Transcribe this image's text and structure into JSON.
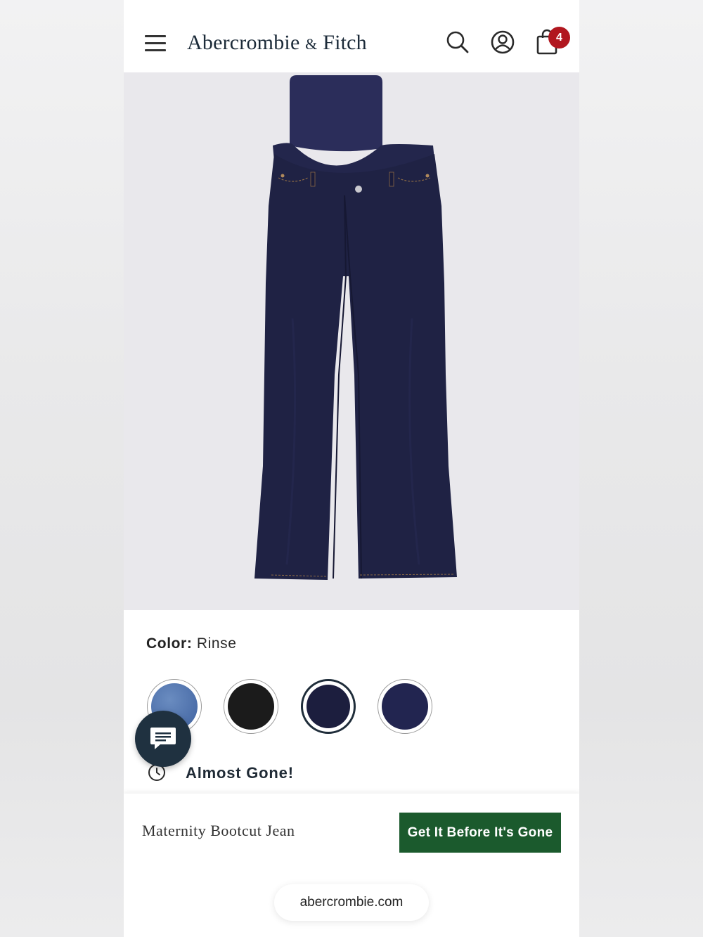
{
  "header": {
    "brand": "Abercrombie",
    "brand_amp": "&",
    "brand_tail": "Fitch",
    "cart_count": "4"
  },
  "product": {
    "color_label": "Color:",
    "color_value": "Rinse",
    "swatches": [
      {
        "name": "light-wash",
        "color": "#4a6ea6"
      },
      {
        "name": "black",
        "color": "#1b1b1b"
      },
      {
        "name": "rinse",
        "color": "#1c1e3e",
        "selected": true
      },
      {
        "name": "dark-navy",
        "color": "#222550"
      }
    ],
    "stock_status": "Almost Gone!",
    "name": "Maternity Bootcut Jean"
  },
  "cta": {
    "label": "Get It Before It's Gone"
  },
  "browser": {
    "url": "abercrombie.com"
  },
  "colors": {
    "cta_green": "#1b5a2d",
    "badge_red": "#b1171f",
    "denim": "#1f2244",
    "panel": "#2b2d5a"
  }
}
